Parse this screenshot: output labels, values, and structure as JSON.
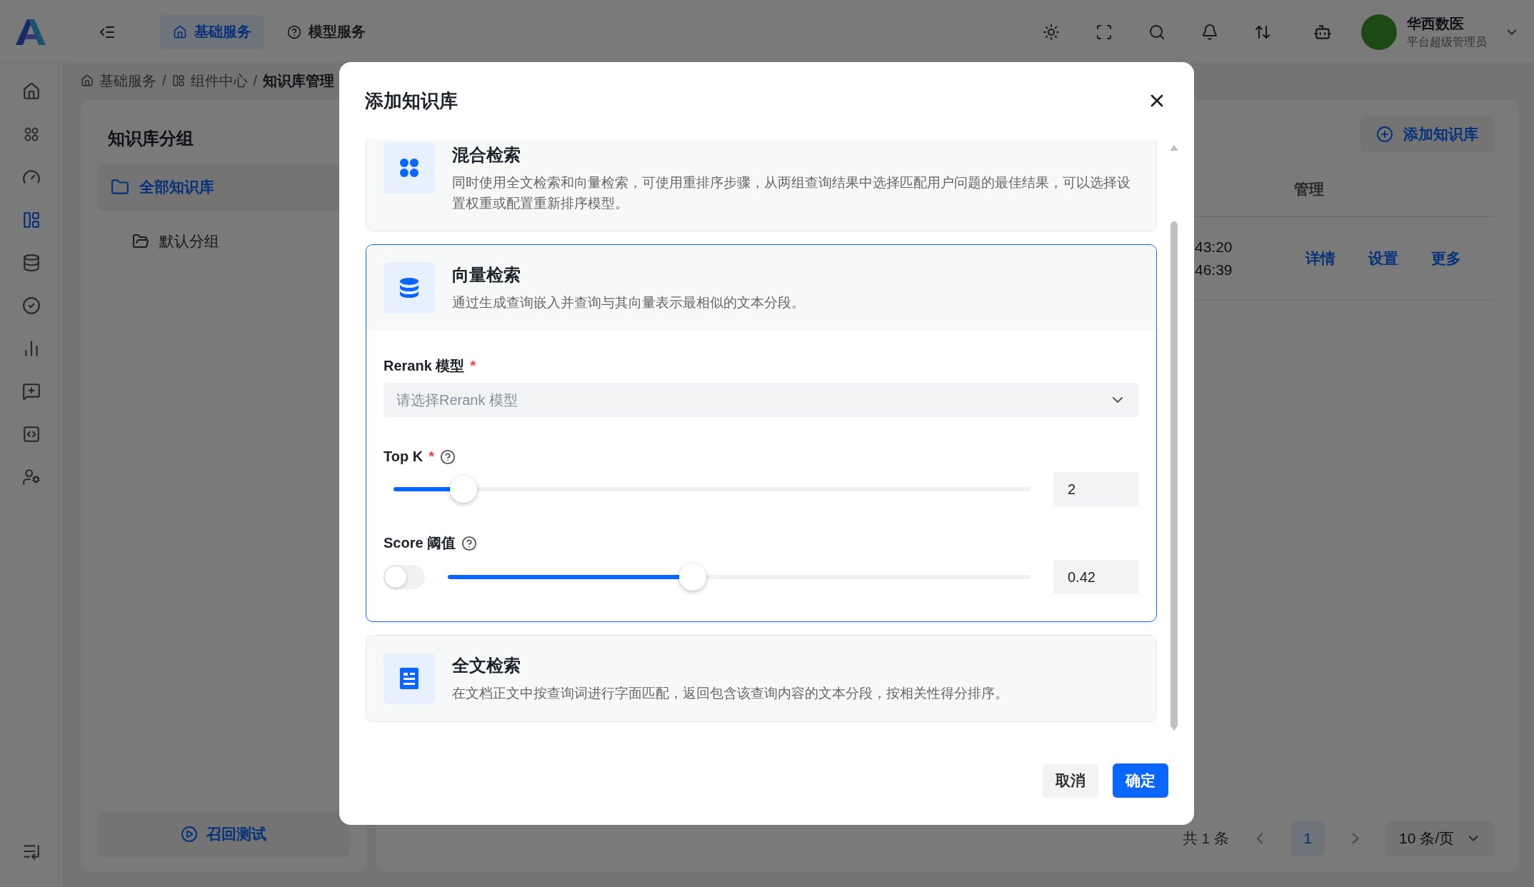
{
  "topbar": {
    "nav_tabs": [
      {
        "label": "基础服务",
        "selected": true
      },
      {
        "label": "模型服务",
        "selected": false
      }
    ],
    "user": {
      "name": "华西数医",
      "role": "平台超级管理员"
    }
  },
  "sidebar": {
    "items": [
      {
        "selected": false
      },
      {
        "selected": false
      },
      {
        "selected": false
      },
      {
        "selected": true
      },
      {
        "selected": false
      },
      {
        "selected": false
      },
      {
        "selected": false
      },
      {
        "selected": false
      },
      {
        "selected": false
      },
      {
        "selected": false
      }
    ]
  },
  "breadcrumb": {
    "items": [
      "基础服务",
      "组件中心",
      "知识库管理"
    ],
    "separator": "/"
  },
  "groups_panel": {
    "title": "知识库分组",
    "items": [
      {
        "label": "全部知识库",
        "selected": true
      },
      {
        "label": "默认分组",
        "selected": false
      }
    ],
    "recall_button": "召回测试"
  },
  "main_panel": {
    "add_button": "添加知识库",
    "table": {
      "columns": [
        "管理"
      ],
      "rows": [
        {
          "times": [
            "43:20",
            "46:39"
          ],
          "actions": [
            "详情",
            "设置",
            "更多"
          ]
        }
      ]
    },
    "pagination": {
      "total": "共 1 条",
      "pages": [
        {
          "label": "1",
          "selected": true
        }
      ],
      "page_size": "10 条/页"
    }
  },
  "dialog": {
    "title": "添加知识库",
    "options": [
      {
        "kind": "hybrid",
        "title": "混合检索",
        "description": "同时使用全文检索和向量检索，可使用重排序步骤，从两组查询结果中选择匹配用户问题的最佳结果，可以选择设置权重或配置重新排序模型。",
        "selected": false
      },
      {
        "kind": "vector",
        "title": "向量检索",
        "description": "通过生成查询嵌入并查询与其向量表示最相似的文本分段。",
        "selected": true
      },
      {
        "kind": "fulltext",
        "title": "全文检索",
        "description": "在文档正文中按查询词进行字面匹配，返回包含该查询内容的文本分段，按相关性得分排序。",
        "selected": false
      }
    ],
    "form": {
      "required_mark": "*",
      "rerank": {
        "label": "Rerank 模型",
        "required": true,
        "placeholder": "请选择Rerank 模型"
      },
      "top_k": {
        "label": "Top K",
        "required": true,
        "level": 0.11,
        "value": "2"
      },
      "score": {
        "label": "Score 阈值",
        "required": false,
        "enabled": false,
        "level": 0.42,
        "value": "0.42"
      }
    },
    "buttons": [
      {
        "label": "取消",
        "kind": "secondary"
      },
      {
        "label": "确定",
        "kind": "primary"
      }
    ]
  }
}
